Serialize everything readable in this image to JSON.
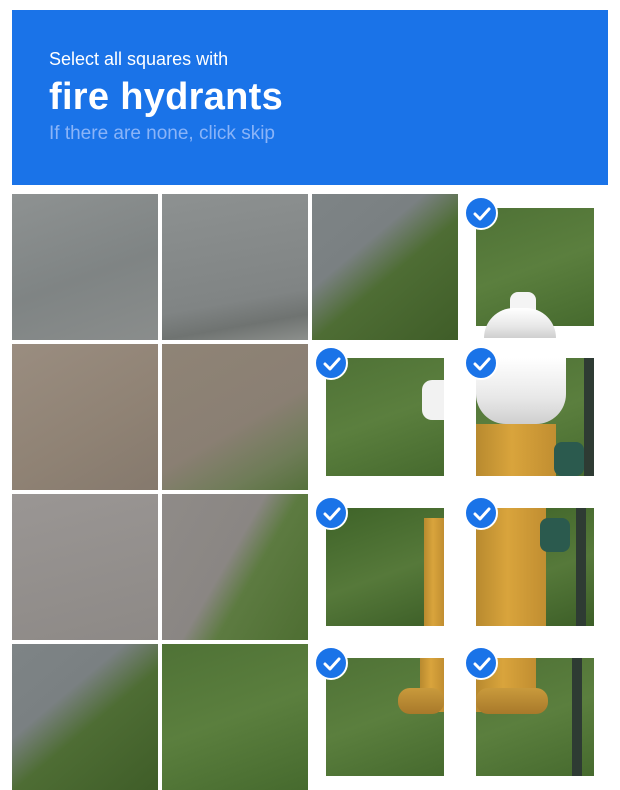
{
  "header": {
    "instruction": "Select all squares with",
    "target": "fire hydrants",
    "hint": "If there are none, click skip"
  },
  "grid": {
    "rows": 4,
    "cols": 4,
    "selected": [
      [
        false,
        false,
        false,
        true
      ],
      [
        false,
        false,
        true,
        true
      ],
      [
        false,
        false,
        true,
        true
      ],
      [
        false,
        false,
        true,
        true
      ]
    ]
  },
  "colors": {
    "accent": "#1a73e8",
    "hint_text": "#8ab4f8",
    "check_badge": "#1a73e8"
  },
  "icons": {
    "check": "checkmark-icon"
  }
}
